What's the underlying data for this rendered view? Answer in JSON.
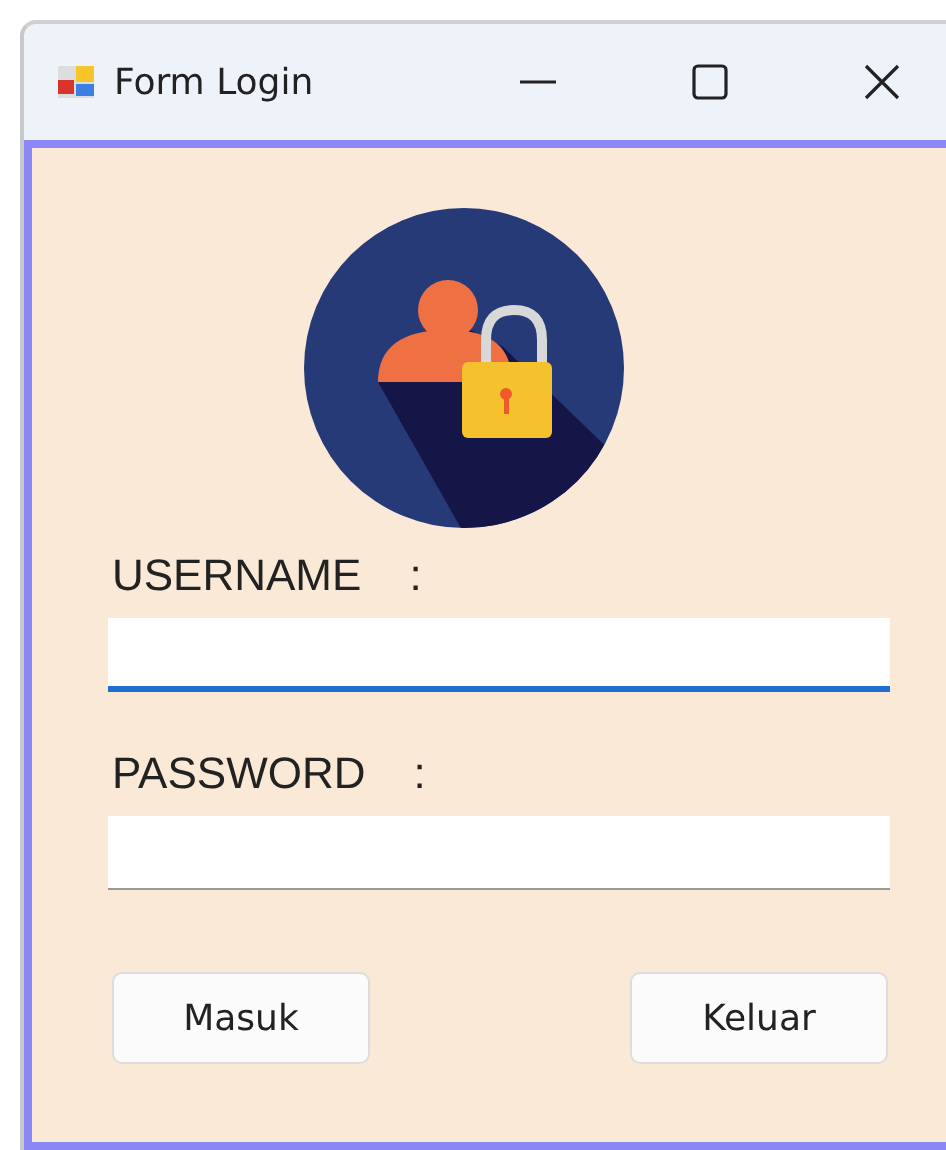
{
  "window": {
    "title": "Form Login"
  },
  "fields": [
    {
      "label": "USERNAME",
      "colon": ":",
      "focused": true
    },
    {
      "label": "PASSWORD",
      "colon": ":",
      "focused": false
    }
  ],
  "buttons": [
    "Masuk",
    "Keluar"
  ]
}
